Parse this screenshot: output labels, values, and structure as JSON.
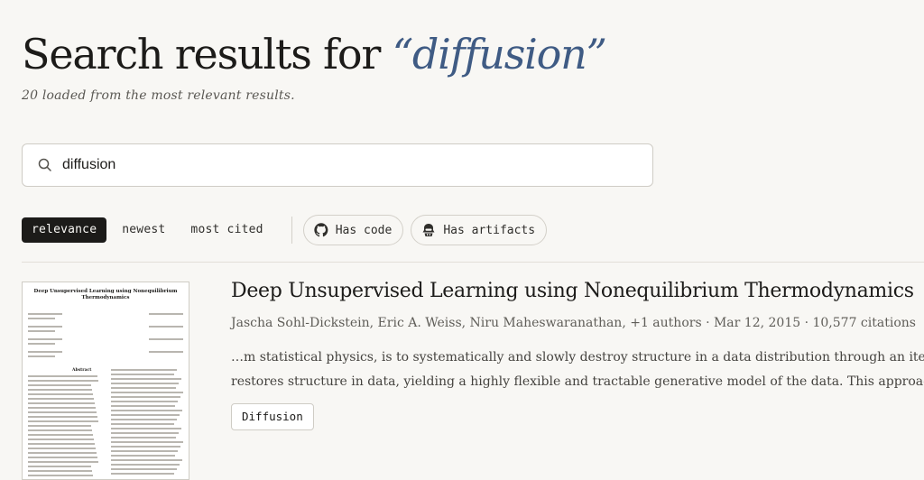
{
  "header": {
    "title_prefix": "Search results for ",
    "query_display": "“diffusion”",
    "subtitle": "20 loaded from the most relevant results."
  },
  "search": {
    "value": "diffusion",
    "icon": "search-icon"
  },
  "sort": {
    "options": [
      "relevance",
      "newest",
      "most cited"
    ],
    "active": "relevance"
  },
  "filters": [
    {
      "label": "Has code",
      "icon": "github-icon"
    },
    {
      "label": "Has artifacts",
      "icon": "artifact-icon"
    }
  ],
  "results": [
    {
      "title": "Deep Unsupervised Learning using Nonequilibrium Thermodynamics",
      "meta": "Jascha Sohl-Dickstein, Eric A. Weiss, Niru Maheswaranathan, +1 authors · Mar 12, 2015 · 10,577 citations",
      "snippet_lines": [
        "…m statistical physics, is to systematically and slowly destroy structure in a data distribution through an iterat",
        "restores structure in data, yielding a highly flexible and tractable generative model of the data. This approach"
      ],
      "tag": "Diffusion",
      "thumbnail": {
        "title": "Deep Unsupervised Learning using Nonequilibrium Thermodynamics",
        "section": "Abstract"
      }
    }
  ],
  "colors": {
    "accent": "#3f5b84",
    "background": "#f8f7f4",
    "active_sort": "#1c1b19"
  }
}
